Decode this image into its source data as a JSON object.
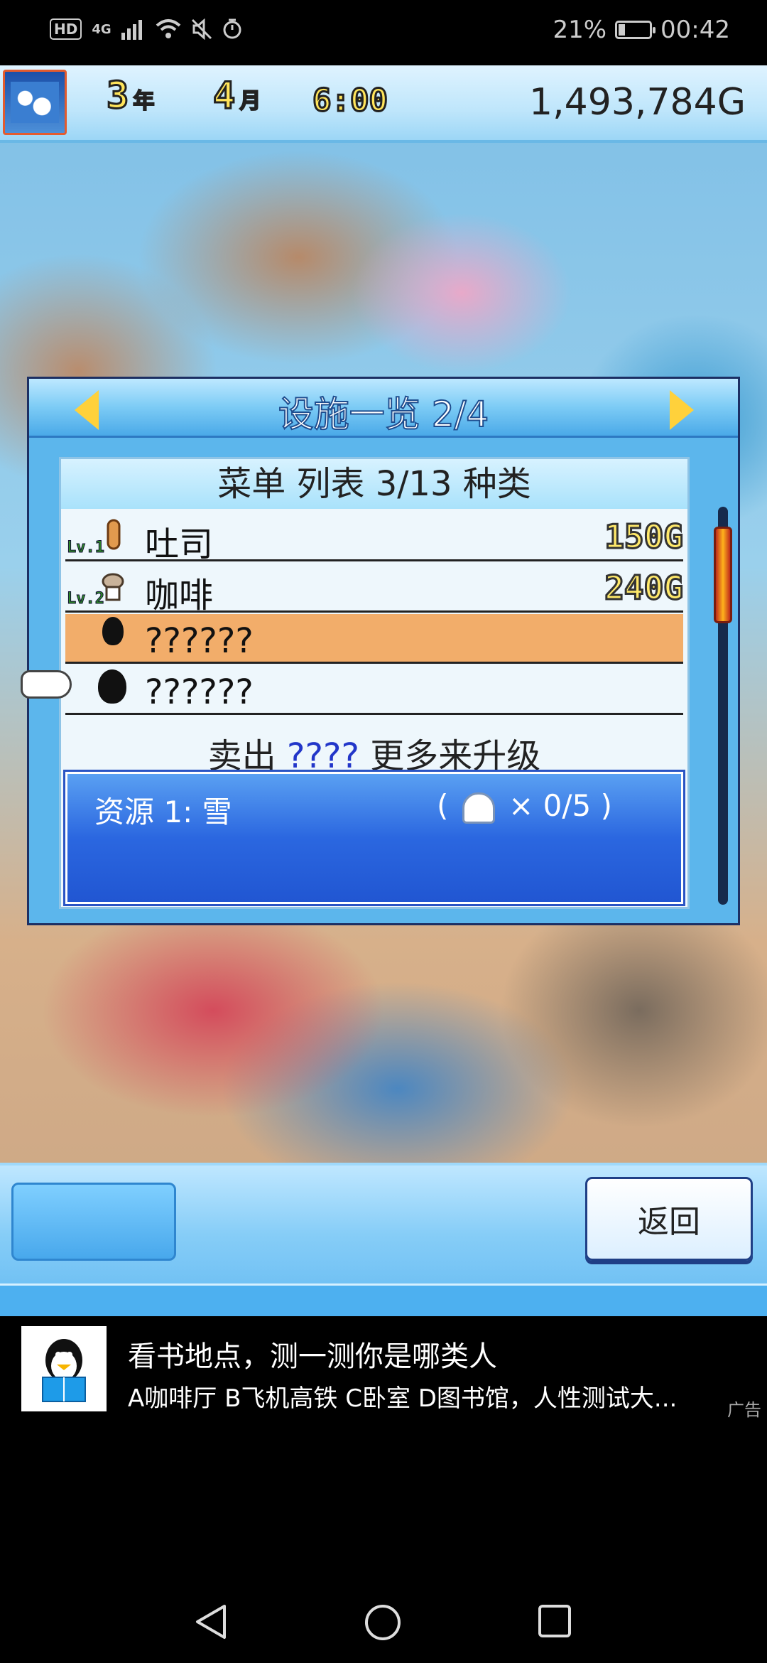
{
  "status_bar": {
    "hd": "HD",
    "network": "4G",
    "battery_percent_text": "21%",
    "battery_level": 0.21,
    "time": "00:42"
  },
  "hud": {
    "year_num": "3",
    "year_unit": "年",
    "month_num": "4",
    "month_unit": "月",
    "clock": "6:00",
    "money": "1,493,784G"
  },
  "dialog": {
    "title": "设施一览 2/4",
    "list_header": "菜单 列表 3/13 种类",
    "items": [
      {
        "level": "Lv.1",
        "name": "吐司",
        "price": "150G"
      },
      {
        "level": "Lv.2",
        "name": "咖啡",
        "price": "240G"
      },
      {
        "level": "",
        "name": "??????",
        "price": ""
      },
      {
        "level": "",
        "name": "??????",
        "price": ""
      }
    ],
    "hint_prefix": "卖出",
    "hint_highlight": "????",
    "hint_suffix": "更多来升级",
    "resource_label": "资源 1: 雪",
    "resource_open": "(",
    "resource_count": "× 0/5 )"
  },
  "buttons": {
    "back_label": "返回"
  },
  "ad": {
    "title": "看书地点，测一测你是哪类人",
    "description": "A咖啡厅 B飞机高铁 C卧室 D图书馆，人性测试大...",
    "tag": "广告"
  },
  "colors": {
    "dialog_blue": "#5cb6ec",
    "selected_row": "#f2ad6a",
    "resource_box": "#2b67e0",
    "price_yellow": "#ffe96a"
  }
}
